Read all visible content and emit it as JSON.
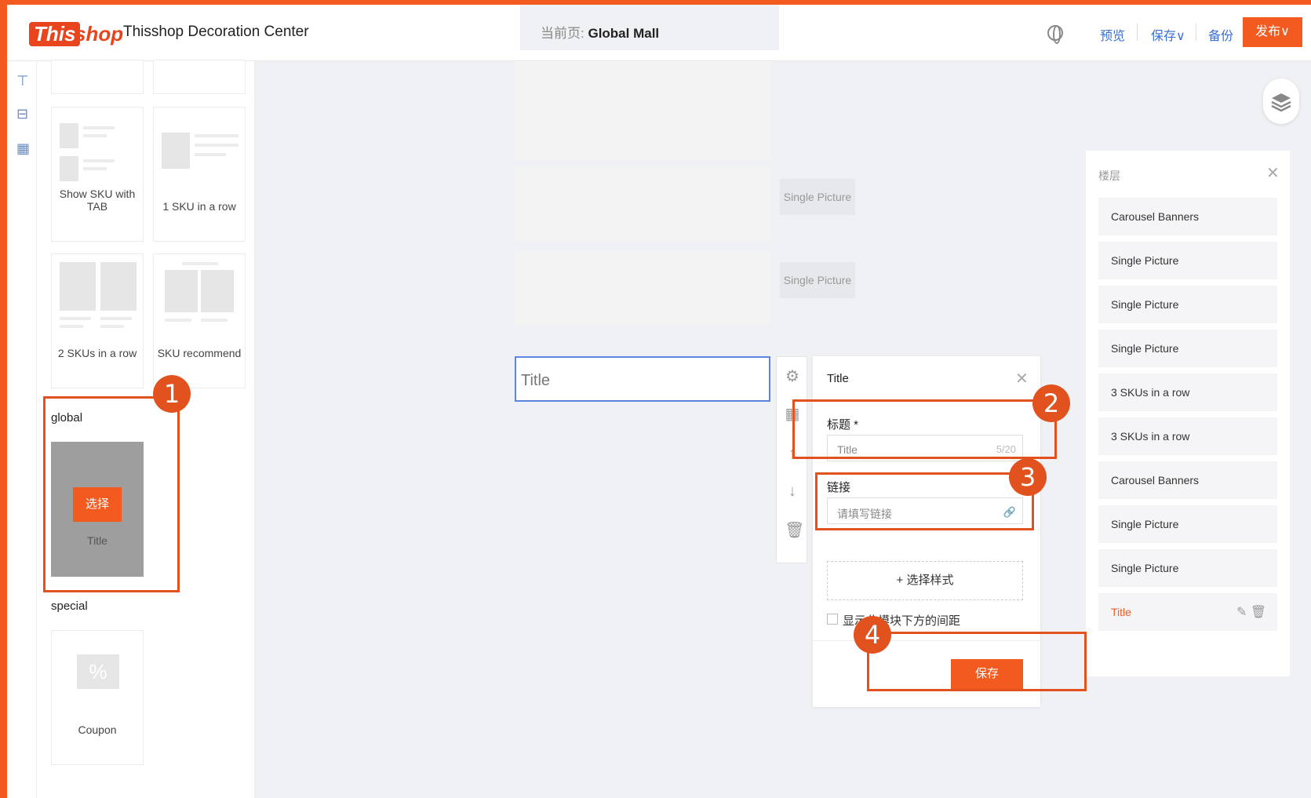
{
  "header": {
    "logo_this": "This",
    "logo_shop": "shop",
    "app_title": "Thisshop Decoration Center",
    "current_page_label": "当前页:",
    "current_page_value": "Global Mall",
    "preview": "预览",
    "save": "保存∨",
    "backup": "备份",
    "publish": "发布∨"
  },
  "components": {
    "cards": [
      {
        "label": "Show SKU with TAB"
      },
      {
        "label": "1 SKU in a row"
      },
      {
        "label": "2 SKUs in a row"
      },
      {
        "label": "SKU recommend"
      }
    ],
    "global_section": "global",
    "global_card": {
      "select_label": "选择",
      "title": "Title"
    },
    "special_section": "special",
    "special_card": {
      "icon": "%",
      "label": "Coupon"
    }
  },
  "canvas": {
    "tags": [
      "Single Picture",
      "Single Picture"
    ],
    "title_box": "Title"
  },
  "edit_panel": {
    "title": "Title",
    "field_title_label": "标题 *",
    "field_title_value": "Title",
    "field_title_count": "5/20",
    "field_link_label": "链接",
    "field_link_placeholder": "请填写链接",
    "style_button": "+ 选择样式",
    "checkbox_label": "显示此模块下方的间距",
    "save_button": "保存"
  },
  "layers": {
    "header": "楼层",
    "items": [
      "Carousel Banners",
      "Single Picture",
      "Single Picture",
      "Single Picture",
      "3 SKUs in a row",
      "3 SKUs in a row",
      "Carousel Banners",
      "Single Picture",
      "Single Picture",
      "Title"
    ]
  },
  "annotations": [
    "1",
    "2",
    "3",
    "4"
  ],
  "colors": {
    "accent": "#f25a1f",
    "annotation": "#e2521f",
    "link": "#3a6fd8"
  }
}
